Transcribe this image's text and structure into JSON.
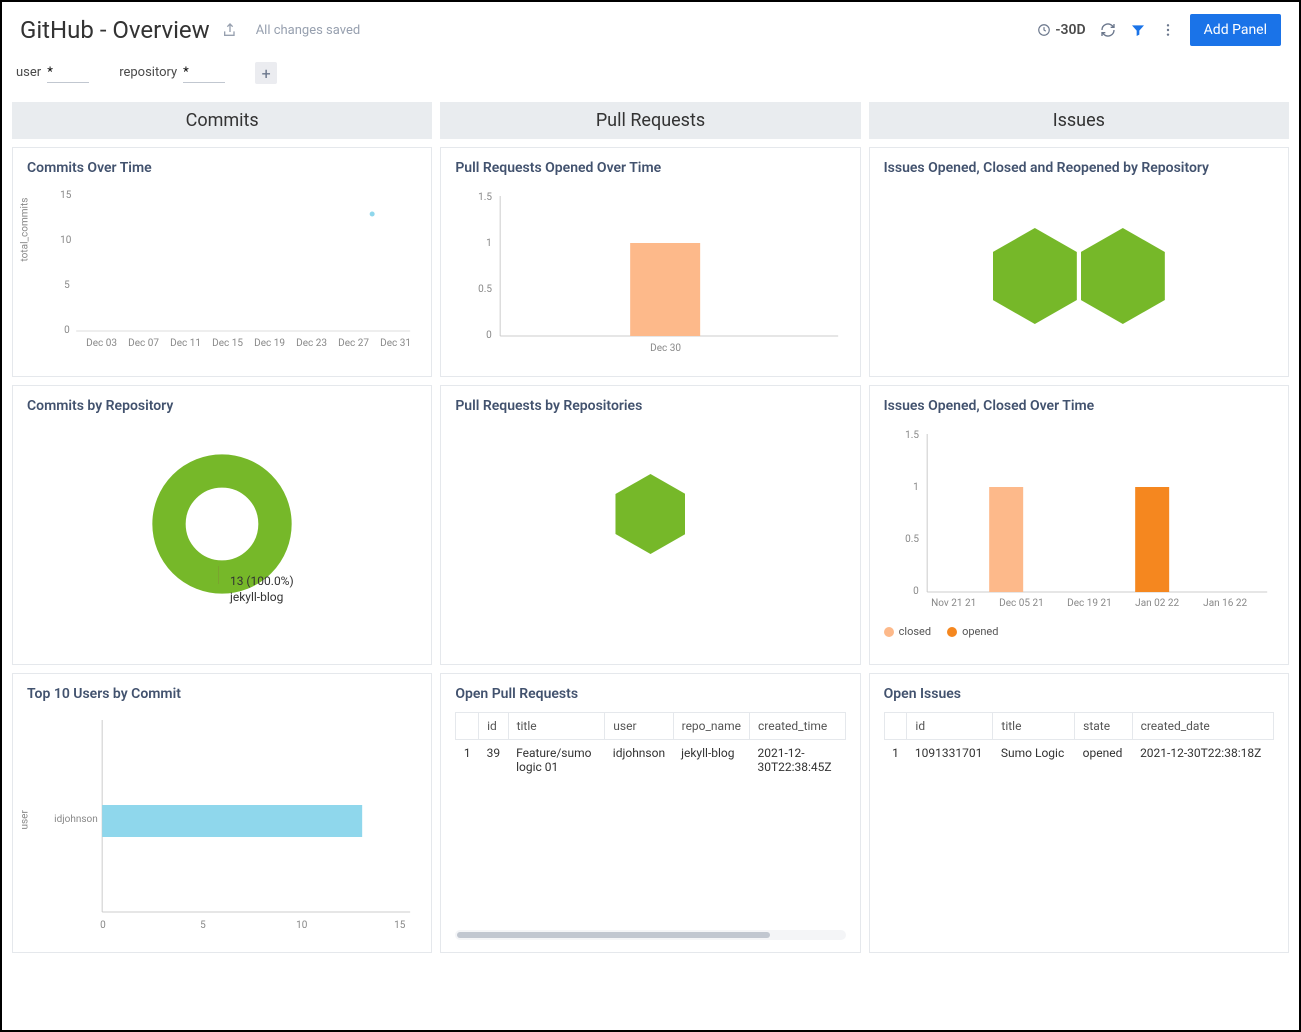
{
  "header": {
    "title": "GitHub - Overview",
    "saved_status": "All changes saved",
    "time_range": "-30D",
    "add_panel_label": "Add Panel"
  },
  "filters": {
    "user_label": "user",
    "user_value": "*",
    "repo_label": "repository",
    "repo_value": "*"
  },
  "sections": {
    "commits": "Commits",
    "pulls": "Pull Requests",
    "issues": "Issues"
  },
  "panels": {
    "commits_over_time": {
      "title": "Commits Over Time",
      "ylabel": "total_commits"
    },
    "pr_opened_over_time": {
      "title": "Pull Requests Opened Over Time"
    },
    "issues_by_repo": {
      "title": "Issues Opened, Closed and Reopened by Repository"
    },
    "commits_by_repo": {
      "title": "Commits by Repository",
      "donut_label_line1": "13 (100.0%)",
      "donut_label_line2": "jekyll-blog"
    },
    "pr_by_repo": {
      "title": "Pull Requests by Repositories"
    },
    "issues_over_time": {
      "title": "Issues Opened, Closed Over Time",
      "legend_closed": "closed",
      "legend_opened": "opened"
    },
    "top_users": {
      "title": "Top 10 Users by Commit",
      "ylabel": "user",
      "user_label": "idjohnson"
    },
    "open_pr": {
      "title": "Open Pull Requests"
    },
    "open_issues": {
      "title": "Open Issues"
    }
  },
  "tables": {
    "open_pr": {
      "headers": {
        "idx": "",
        "id": "id",
        "title": "title",
        "user": "user",
        "repo_name": "repo_name",
        "created_time": "created_time"
      },
      "row1": {
        "idx": "1",
        "id": "39",
        "title": "Feature/sumo logic 01",
        "user": "idjohnson",
        "repo_name": "jekyll-blog",
        "created_time": "2021-12-30T22:38:45Z"
      }
    },
    "open_issues": {
      "headers": {
        "idx": "",
        "id": "id",
        "title": "title",
        "state": "state",
        "created_date": "created_date"
      },
      "row1": {
        "idx": "1",
        "id": "1091331701",
        "title": "Sumo Logic",
        "state": "opened",
        "created_date": "2021-12-30T22:38:18Z"
      }
    }
  },
  "chart_data": [
    {
      "type": "scatter",
      "title": "Commits Over Time",
      "ylabel": "total_commits",
      "x_ticks": [
        "Dec 03",
        "Dec 07",
        "Dec 11",
        "Dec 15",
        "Dec 19",
        "Dec 23",
        "Dec 27",
        "Dec 31"
      ],
      "y_ticks": [
        0,
        5,
        10,
        15
      ],
      "ylim": [
        0,
        15
      ],
      "series": [
        {
          "name": "commits",
          "points": [
            {
              "x": "Dec 30",
              "y": 13
            }
          ]
        }
      ]
    },
    {
      "type": "bar",
      "title": "Pull Requests Opened Over Time",
      "categories": [
        "Dec 30"
      ],
      "values": [
        1
      ],
      "y_ticks": [
        0,
        0.5,
        1,
        1.5
      ],
      "ylim": [
        0,
        1.5
      ],
      "color": "#fdb98a"
    },
    {
      "type": "pie",
      "title": "Commits by Repository",
      "slices": [
        {
          "label": "jekyll-blog",
          "value": 13,
          "percent": 100.0,
          "color": "#76b829"
        }
      ]
    },
    {
      "type": "bar",
      "title": "Issues Opened, Closed Over Time",
      "categories": [
        "Nov 21 21",
        "Dec 05 21",
        "Dec 19 21",
        "Jan 02 22",
        "Jan 16 22"
      ],
      "series": [
        {
          "name": "closed",
          "color": "#fdb98a",
          "values": [
            0,
            1,
            0,
            0,
            0
          ]
        },
        {
          "name": "opened",
          "color": "#f5871f",
          "values": [
            0,
            0,
            0,
            1,
            0
          ]
        }
      ],
      "y_ticks": [
        0,
        0.5,
        1,
        1.5
      ],
      "ylim": [
        0,
        1.5
      ]
    },
    {
      "type": "bar",
      "title": "Top 10 Users by Commit",
      "orientation": "horizontal",
      "categories": [
        "idjohnson"
      ],
      "values": [
        13
      ],
      "x_ticks": [
        0,
        5,
        10,
        15
      ],
      "xlim": [
        0,
        15
      ],
      "xlabel": "",
      "ylabel": "user",
      "color": "#8fd7ec"
    }
  ],
  "colors": {
    "green": "#76b829",
    "peach": "#fdb98a",
    "orange": "#f5871f",
    "cyan": "#8fd7ec",
    "blue": "#1a73e8"
  }
}
